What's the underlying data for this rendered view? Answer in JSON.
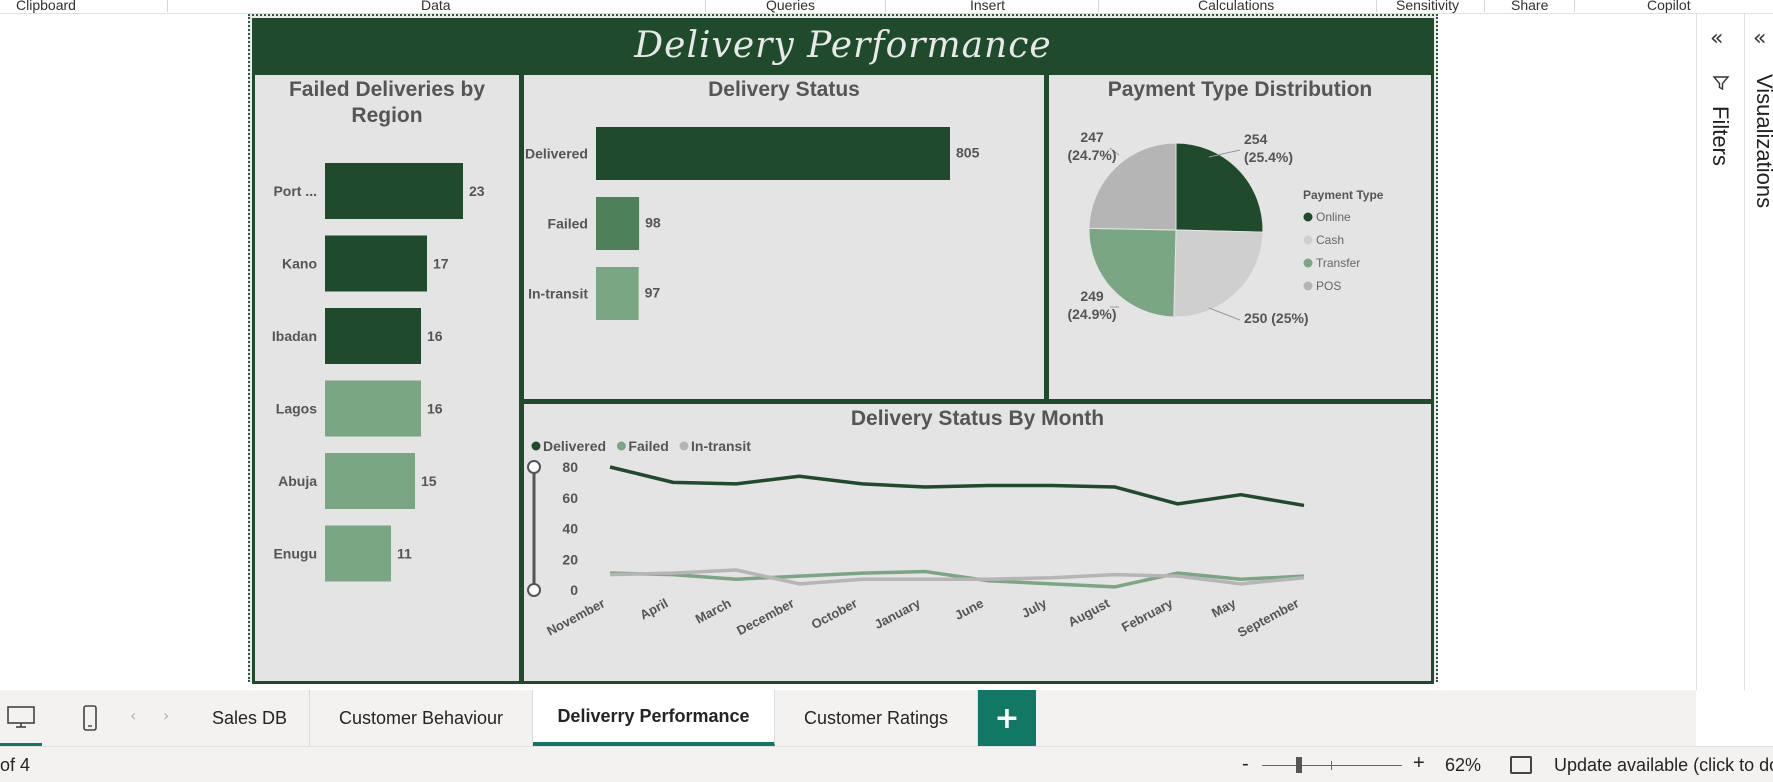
{
  "ribbon": {
    "groups": [
      "Clipboard",
      "Data",
      "Queries",
      "Insert",
      "Calculations",
      "Sensitivity",
      "Share",
      "Copilot"
    ]
  },
  "report": {
    "title": "Delivery Performance",
    "colors": {
      "dark_green": "#1f4a2c",
      "mid_green": "#4e8059",
      "light_green": "#7aa684",
      "light_gray": "#cfcfcf",
      "gray": "#b5b5b5"
    }
  },
  "chart_data": [
    {
      "type": "bar",
      "title": "Failed Deliveries by Region",
      "orientation": "horizontal",
      "categories": [
        "Port ...",
        "Kano",
        "Ibadan",
        "Lagos",
        "Abuja",
        "Enugu"
      ],
      "values": [
        23,
        17,
        16,
        16,
        15,
        11
      ],
      "bar_colors": [
        "#1f4a2c",
        "#1f4a2c",
        "#1f4a2c",
        "#7aa684",
        "#7aa684",
        "#7aa684"
      ],
      "data_labels": true
    },
    {
      "type": "bar",
      "title": "Delivery Status",
      "orientation": "horizontal",
      "categories": [
        "Delivered",
        "Failed",
        "In-transit"
      ],
      "values": [
        805,
        98,
        97
      ],
      "bar_colors": [
        "#1f4a2c",
        "#4e8059",
        "#7aa684"
      ],
      "data_labels": true
    },
    {
      "type": "pie",
      "title": "Payment Type Distribution",
      "legend_title": "Payment Type",
      "legend_position": "right",
      "slices": [
        {
          "name": "Online",
          "value": 254,
          "label_value": "254",
          "label_pct": "(25.4%)",
          "color": "#1f4a2c"
        },
        {
          "name": "Cash",
          "value": 250,
          "label_value": "250",
          "label_pct": "(25%)",
          "color": "#cfcfcf"
        },
        {
          "name": "Transfer",
          "value": 249,
          "label_value": "249",
          "label_pct": "(24.9%)",
          "color": "#7aa684"
        },
        {
          "name": "POS",
          "value": 247,
          "label_value": "247",
          "label_pct": "(24.7%)",
          "color": "#b5b5b5"
        }
      ]
    },
    {
      "type": "line",
      "title": "Delivery Status By Month",
      "legend_position": "top-left",
      "categories": [
        "November",
        "April",
        "March",
        "December",
        "October",
        "January",
        "June",
        "July",
        "August",
        "February",
        "May",
        "September"
      ],
      "y_ticks": [
        0,
        20,
        40,
        60,
        80
      ],
      "ylim": [
        0,
        80
      ],
      "series": [
        {
          "name": "Delivered",
          "color": "#1f4a2c",
          "values": [
            80,
            70,
            69,
            74,
            69,
            67,
            68,
            68,
            67,
            56,
            62,
            55
          ]
        },
        {
          "name": "Failed",
          "color": "#7aa684",
          "values": [
            11,
            10,
            7,
            9,
            11,
            12,
            6,
            4,
            2,
            11,
            7,
            9
          ]
        },
        {
          "name": "In-transit",
          "color": "#b5b5b5",
          "values": [
            10,
            11,
            13,
            4,
            7,
            7,
            7,
            8,
            10,
            9,
            4,
            8
          ]
        }
      ]
    }
  ],
  "right_panes": {
    "filters_label": "Filters",
    "visualizations_label": "Visualizations"
  },
  "tabs": {
    "pages": [
      "Sales DB",
      "Customer Behaviour",
      "Deliverry Performance",
      "Customer Ratings"
    ],
    "active_index": 2,
    "add_label": "+"
  },
  "status": {
    "page_count": "of 4",
    "zoom_minus": "-",
    "zoom_plus": "+",
    "zoom_percent": "62%",
    "zoom_fraction": 0.62,
    "update_text": "Update available (click to do"
  }
}
